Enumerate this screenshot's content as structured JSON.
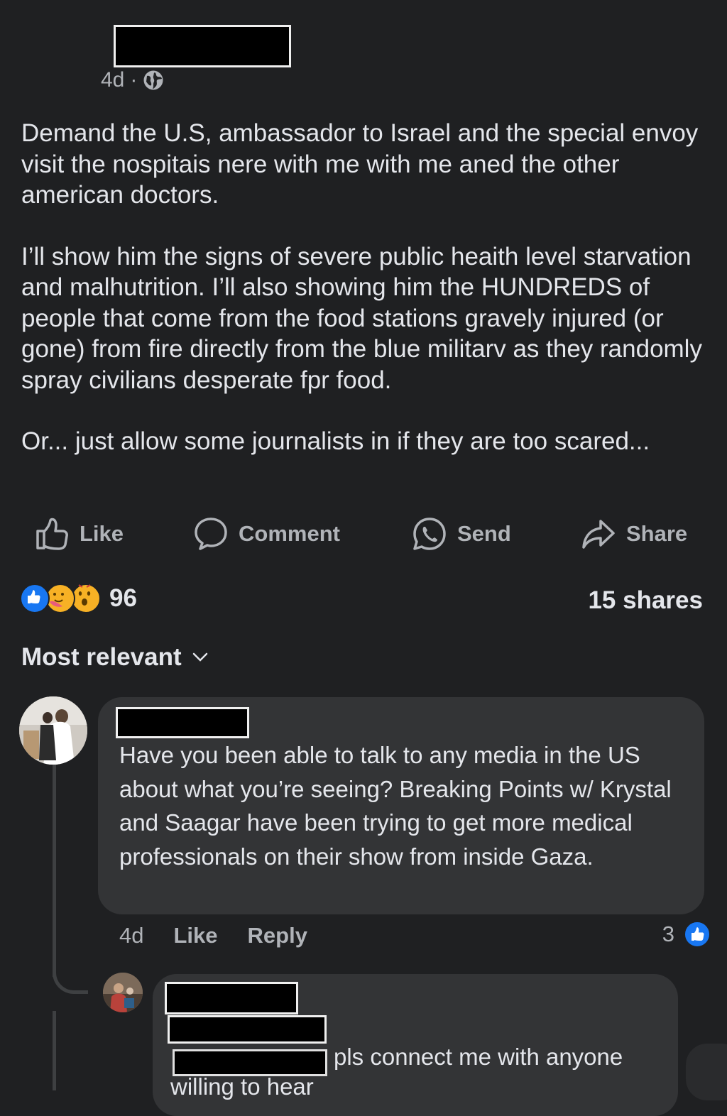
{
  "post": {
    "timestamp": "4d",
    "separator": "·",
    "paragraphs": [
      "Demand the U.S, ambassador to Israel and the special envoy visit the nospitais nere with me with me aned the other american doctors.",
      "I’ll show him the signs of severe public heaith level starvation and malhutrition. I’ll also showing him the HUNDREDS of people that come from the food stations gravely injured (or gone) from fire directly from the blue militarv as they randomly spray civilians desperate fpr food.",
      "Or... just allow some journalists in if they are too scared..."
    ]
  },
  "actions": {
    "like": "Like",
    "comment": "Comment",
    "send": "Send",
    "share": "Share"
  },
  "stats": {
    "reaction_count": "96",
    "shares": "15 shares",
    "reactions": [
      "like-icon",
      "care-icon",
      "wow-icon"
    ]
  },
  "sort": {
    "label": "Most relevant"
  },
  "comment1": {
    "text": "Have you been able to talk to any media in the US about what you’re seeing? Breaking Points w/ Krystal and Saagar have been trying to get more medical professionals on their show from inside Gaza.",
    "time": "4d",
    "like_label": "Like",
    "reply_label": "Reply",
    "like_count": "3"
  },
  "reply1": {
    "text_line1": "pls connect me with anyone",
    "text_line2": "willing to hear"
  },
  "colors": {
    "background": "#1f2022",
    "bubble": "#333436",
    "text": "#e4e6eb",
    "secondary": "#b0b3b8",
    "like_blue": "#1877f2"
  }
}
